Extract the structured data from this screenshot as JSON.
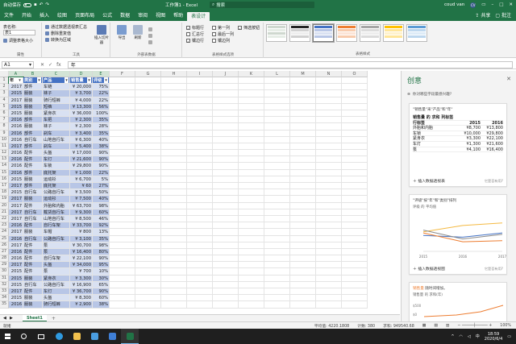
{
  "titlebar": {
    "autosave": "自动保存",
    "title": "工作簿1 - Excel",
    "search": "搜索",
    "user": "coud van",
    "user_initials": "CV"
  },
  "menu": {
    "items": [
      "文件",
      "开始",
      "插入",
      "绘图",
      "页面布局",
      "公式",
      "数据",
      "审阅",
      "视图",
      "帮助",
      "表设计"
    ],
    "active": "表设计",
    "share": "共享",
    "comment": "批注"
  },
  "ribbon": {
    "props": {
      "label1": "表名称:",
      "value": "表1",
      "resize": "调整表格大小",
      "group": "属性"
    },
    "tools": {
      "items": [
        "通过数据透视表汇总",
        "删除重复值",
        "转换为区域"
      ],
      "slicer": "插入切片器",
      "group": "工具"
    },
    "external": {
      "buttons": [
        "导出",
        "刷新"
      ],
      "group": "外部表数据"
    },
    "options": {
      "col1": [
        "标题行",
        "汇总行",
        "镶边行"
      ],
      "col2": [
        "第一列",
        "最后一列",
        "镶边列"
      ],
      "filter": "筛选按钮",
      "checked": [
        true,
        false,
        true,
        false,
        false,
        false,
        true
      ],
      "group": "表格样式选项"
    },
    "styles": {
      "group": "表格样式"
    }
  },
  "formula": {
    "cell": "A1",
    "value": "年",
    "fx": "fx"
  },
  "sheet": {
    "columns": [
      "A",
      "B",
      "C",
      "D",
      "E",
      "F",
      "G",
      "H",
      "I",
      "J",
      "K",
      "L",
      "M",
      "N",
      "O"
    ],
    "headers": [
      "年",
      "类别",
      "产品",
      "销售量",
      "评级"
    ],
    "rows": [
      [
        "2017",
        "部件",
        "车链",
        "¥ 20,000",
        "75%"
      ],
      [
        "2015",
        "服装",
        "袜子",
        "¥ 3,700",
        "22%"
      ],
      [
        "2017",
        "服装",
        "骑行短裤",
        "¥ 4,000",
        "22%"
      ],
      [
        "2015",
        "服装",
        "短裤",
        "¥ 13,300",
        "56%"
      ],
      [
        "2015",
        "服装",
        "紧身衣",
        "¥ 36,000",
        "100%"
      ],
      [
        "2016",
        "部件",
        "车把",
        "¥ 2,300",
        "35%"
      ],
      [
        "2016",
        "服装",
        "袜子",
        "¥ 2,300",
        "28%"
      ],
      [
        "2016",
        "部件",
        "刹车",
        "¥ 3,400",
        "35%"
      ],
      [
        "2016",
        "自行车",
        "山地自行车",
        "¥ 6,300",
        "40%"
      ],
      [
        "2017",
        "部件",
        "刹车",
        "¥ 5,400",
        "38%"
      ],
      [
        "2016",
        "配件",
        "头盔",
        "¥ 17,000",
        "90%"
      ],
      [
        "2016",
        "配件",
        "车灯",
        "¥ 21,600",
        "90%"
      ],
      [
        "2016",
        "配件",
        "车锁",
        "¥ 29,800",
        "90%"
      ],
      [
        "2016",
        "部件",
        "底托架",
        "¥ 1,000",
        "22%"
      ],
      [
        "2015",
        "服装",
        "运动衫",
        "¥ 6,700",
        "5%"
      ],
      [
        "2017",
        "部件",
        "底托架",
        "¥ 60",
        "27%"
      ],
      [
        "2015",
        "自行车",
        "公路自行车",
        "¥ 3,500",
        "50%"
      ],
      [
        "2017",
        "服装",
        "运动衫",
        "¥ 7,500",
        "40%"
      ],
      [
        "2017",
        "配件",
        "外胎和内胎",
        "¥ 63,700",
        "98%"
      ],
      [
        "2017",
        "自行车",
        "载货自行车",
        "¥ 9,300",
        "60%"
      ],
      [
        "2017",
        "自行车",
        "山地自行车",
        "¥ 8,500",
        "46%"
      ],
      [
        "2016",
        "配件",
        "自行车架",
        "¥ 33,700",
        "92%"
      ],
      [
        "2017",
        "服装",
        "车帽",
        "¥ 800",
        "13%"
      ],
      [
        "2016",
        "自行车",
        "公路自行车",
        "¥ 3,100",
        "35%"
      ],
      [
        "2017",
        "配件",
        "泵",
        "¥ 30,700",
        "98%"
      ],
      [
        "2016",
        "配件",
        "泵",
        "¥ 16,400",
        "80%"
      ],
      [
        "2016",
        "配件",
        "自行车架",
        "¥ 22,100",
        "90%"
      ],
      [
        "2017",
        "配件",
        "头盔",
        "¥ 34,000",
        "95%"
      ],
      [
        "2015",
        "配件",
        "泵",
        "¥ 700",
        "10%"
      ],
      [
        "2015",
        "服装",
        "紧身衣",
        "¥ 3,300",
        "30%"
      ],
      [
        "2015",
        "自行车",
        "公路自行车",
        "¥ 16,900",
        "65%"
      ],
      [
        "2017",
        "配件",
        "车灯",
        "¥ 36,700",
        "90%"
      ],
      [
        "2015",
        "服装",
        "头盔",
        "¥ 8,300",
        "60%"
      ],
      [
        "2016",
        "服装",
        "骑行短裤",
        "¥ 2,900",
        "38%"
      ]
    ],
    "tab": "Sheet1",
    "add": "+"
  },
  "pane": {
    "title": "创意",
    "hint": "你对哪些字段最感兴趣?",
    "card1": {
      "question": "\"销售量\"采\"产品\"和\"年\"",
      "caption": "销售量 的 求和  列标签",
      "row_label": "行标签",
      "years": [
        "2015",
        "2016"
      ],
      "rows": [
        [
          "外胎和内胎",
          "¥8,700",
          "¥13,800"
        ],
        [
          "车锁",
          "¥10,000",
          "¥29,800"
        ],
        [
          "紧身衣",
          "¥3,300",
          "¥22,100"
        ],
        [
          "车灯",
          "¥1,300",
          "¥21,600"
        ],
        [
          "泵",
          "¥4,100",
          "¥16,400"
        ]
      ],
      "action": "插入数据透视表",
      "feedback": "它是否有用?"
    },
    "card2": {
      "question": "\"评级\"按\"年\"和\"类别\"排列",
      "subtitle": "评级 的 平均值",
      "x": [
        "2015",
        "2016",
        "2017"
      ],
      "series": [
        {
          "name": "配件",
          "values": [
            55,
            73,
            80
          ],
          "color": "#f4b942"
        },
        {
          "name": "自行车",
          "values": [
            45,
            40,
            52
          ],
          "color": "#4472c4"
        },
        {
          "name": "服装",
          "values": [
            52,
            27,
            30
          ],
          "color": "#ed7d31"
        },
        {
          "name": "部件",
          "values": [
            60,
            35,
            48
          ],
          "color": "#8a8a8a"
        }
      ],
      "ylim": [
        0,
        100
      ],
      "action": "插入数据透视图",
      "feedback": "它是否有用?"
    },
    "card3": {
      "highlight": "销售量",
      "question_rest": " 随时间增加。",
      "subtitle": "销售量 的 求和(年)",
      "yticks": [
        "$500",
        "$0"
      ]
    }
  },
  "status": {
    "ready": "就绪",
    "avg": "平均值: 4220.1808",
    "count": "计数: 380",
    "sum": "求和: 949540.68",
    "zoom": "100%"
  },
  "taskbar": {
    "time": "18:59",
    "date": "2020/6/4",
    "lang": "中"
  },
  "colors": {
    "excel_green": "#217346",
    "table_header": "#4472c4",
    "band_dark": "#b8c6e6",
    "band_light": "#d9e1f2"
  }
}
